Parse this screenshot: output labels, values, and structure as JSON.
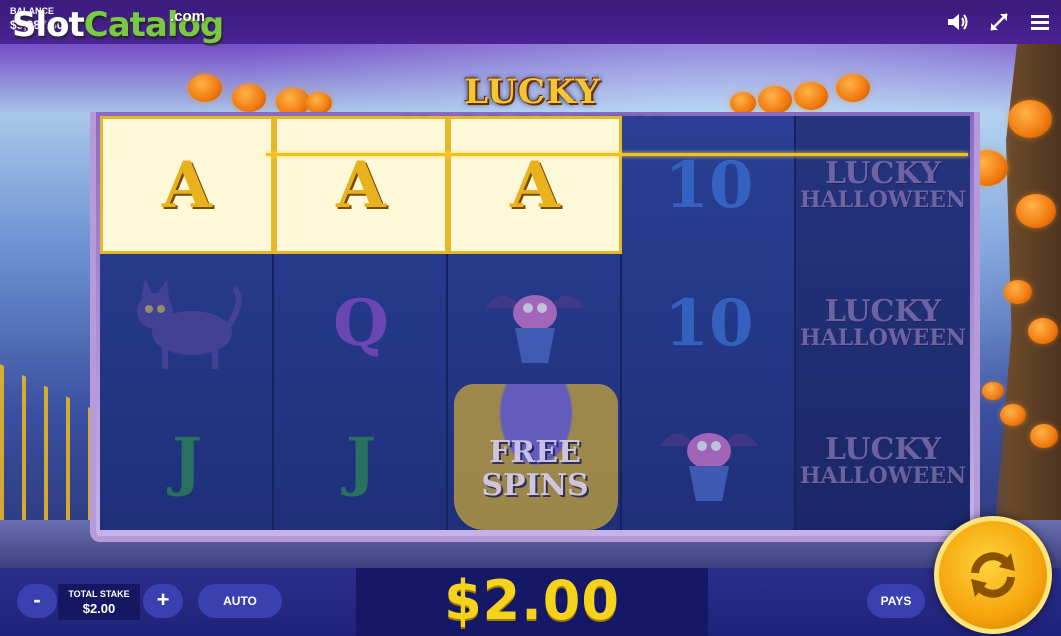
{
  "header": {
    "balance_label": "BALANCE",
    "balance_value": "$9,987.50",
    "watermark_slot": "Slot",
    "watermark_catalog": "Catalog",
    "watermark_com": ".com",
    "icons": [
      "sound-icon",
      "fullscreen-icon",
      "menu-icon"
    ]
  },
  "game": {
    "title": "LUCKY HALLOWEEN"
  },
  "reels": [
    {
      "top": "A",
      "middle": "cat",
      "bottom": "J"
    },
    {
      "top": "A",
      "middle": "Q",
      "bottom": "J"
    },
    {
      "top": "A",
      "middle": "cupcake",
      "bottom": "free-spins"
    },
    {
      "top": "10",
      "middle": "10",
      "bottom": "cupcake"
    },
    {
      "top": "lucky-halloween",
      "middle": "lucky-halloween",
      "bottom": "lucky-halloween"
    }
  ],
  "symbols": {
    "A": "A",
    "Q": "Q",
    "J": "J",
    "ten": "10",
    "free_spins_line1": "FREE",
    "free_spins_line2": "SPINS",
    "logo_line1": "LUCKY",
    "logo_line2": "HALLOWEEN"
  },
  "footer": {
    "minus_label": "-",
    "plus_label": "+",
    "total_stake_label": "TOTAL STAKE",
    "total_stake_value": "$2.00",
    "auto_label": "AUTO",
    "win_amount": "$2.00",
    "pays_label": "PAYS"
  },
  "colors": {
    "accent_gold": "#f5d21c",
    "bar_blue": "#2b2f8a",
    "button_blue": "#3a40b0"
  }
}
